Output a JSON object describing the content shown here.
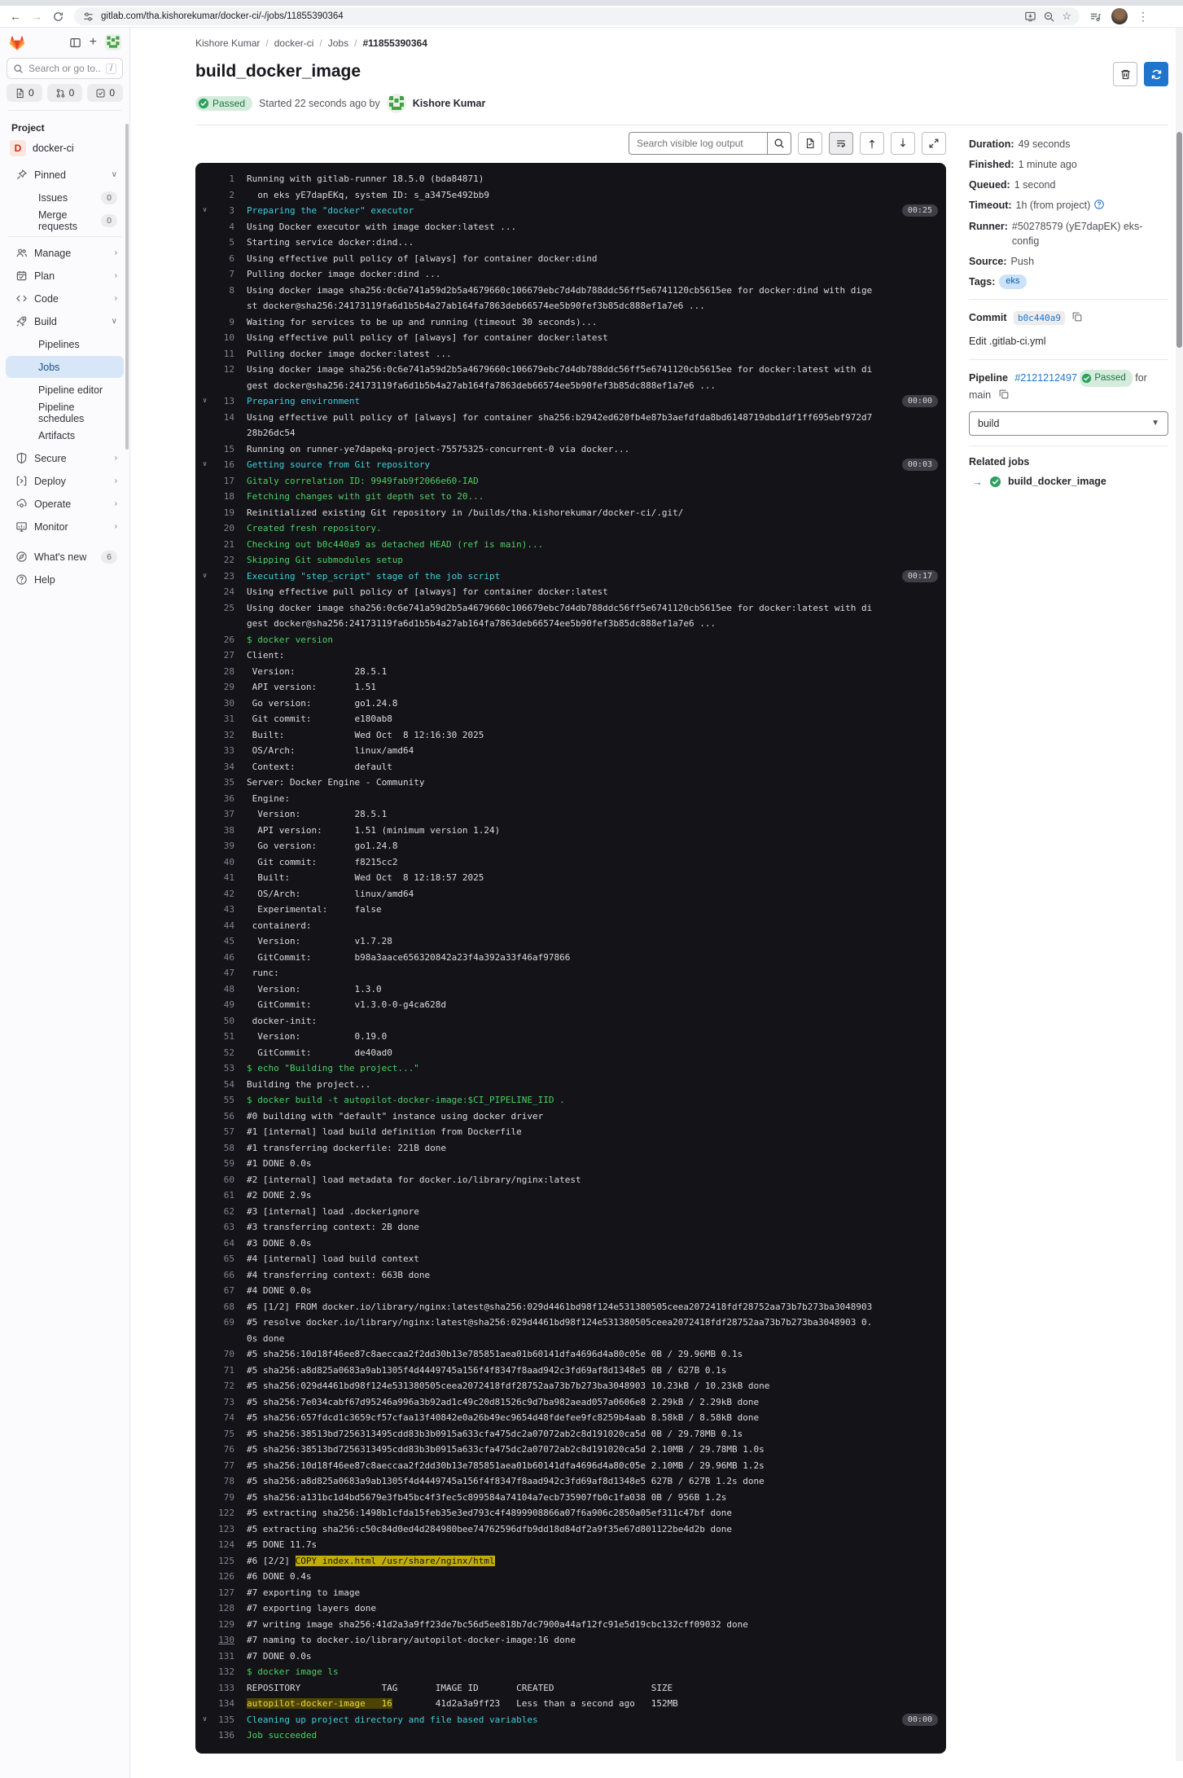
{
  "browser": {
    "url": "gitlab.com/tha.kishorekumar/docker-ci/-/jobs/11855390364"
  },
  "breadcrumb": {
    "items": [
      "Kishore Kumar",
      "docker-ci",
      "Jobs",
      "#11855390364"
    ]
  },
  "sidebar": {
    "search_placeholder": "Search or go to...",
    "shortcut_key": "/",
    "counts": [
      {
        "icon": "issues-count-icon",
        "glyph": "doc",
        "value": "0"
      },
      {
        "icon": "merge-request-count-icon",
        "glyph": "mr",
        "value": "0"
      },
      {
        "icon": "todos-count-icon",
        "glyph": "tasks",
        "value": "0"
      }
    ],
    "section_label": "Project",
    "project": {
      "initial": "D",
      "name": "docker-ci"
    },
    "nav": [
      {
        "label": "Pinned",
        "icon": "pin",
        "chevron": "down"
      },
      {
        "label": "Issues",
        "sub": true,
        "badge": "0"
      },
      {
        "label": "Merge requests",
        "sub": true,
        "badge": "0"
      },
      {
        "divider": true
      },
      {
        "label": "Manage",
        "icon": "users",
        "chevron": "right"
      },
      {
        "label": "Plan",
        "icon": "calendar",
        "chevron": "right"
      },
      {
        "label": "Code",
        "icon": "code",
        "chevron": "right"
      },
      {
        "label": "Build",
        "icon": "rocket",
        "chevron": "down"
      },
      {
        "label": "Pipelines",
        "sub": true
      },
      {
        "label": "Jobs",
        "sub": true,
        "active": true
      },
      {
        "label": "Pipeline editor",
        "sub": true
      },
      {
        "label": "Pipeline schedules",
        "sub": true
      },
      {
        "label": "Artifacts",
        "sub": true
      },
      {
        "label": "Secure",
        "icon": "shield",
        "chevron": "right"
      },
      {
        "label": "Deploy",
        "icon": "deploy",
        "chevron": "right"
      },
      {
        "label": "Operate",
        "icon": "operate",
        "chevron": "right"
      },
      {
        "label": "Monitor",
        "icon": "monitor",
        "chevron": "right"
      }
    ],
    "footer": [
      {
        "label": "What's new",
        "icon": "compass",
        "badge": "6"
      },
      {
        "label": "Help",
        "icon": "question"
      }
    ]
  },
  "job": {
    "title": "build_docker_image",
    "status": "Passed",
    "started_text": "Started 22 seconds ago by",
    "author": "Kishore Kumar"
  },
  "log_toolbar": {
    "search_placeholder": "Search visible log output"
  },
  "details": {
    "rows": [
      {
        "label": "Duration:",
        "value": "49 seconds"
      },
      {
        "label": "Finished:",
        "value": "1 minute ago"
      },
      {
        "label": "Queued:",
        "value": "1 second"
      },
      {
        "label": "Timeout:",
        "value": "1h (from project)",
        "help": true
      },
      {
        "label": "Runner:",
        "value": "#50278579 (yE7dapEK) eks-config"
      },
      {
        "label": "Source:",
        "value": "Push"
      },
      {
        "label": "Tags:",
        "tag": "eks"
      }
    ],
    "commit_label": "Commit",
    "commit_sha": "b0c440a9",
    "edit_link": "Edit .gitlab-ci.yml",
    "pipeline_label": "Pipeline",
    "pipeline_id": "#2121212497",
    "pipeline_status": "Passed",
    "pipeline_for": "for main",
    "stage_selector": "build",
    "related_jobs_label": "Related jobs",
    "related_jobs": [
      {
        "name": "build_docker_image",
        "status": "passed"
      }
    ]
  },
  "log": {
    "lines": [
      {
        "n": 1,
        "c": "w",
        "t": "Running with gitlab-runner 18.5.0 (bda84871)"
      },
      {
        "n": 2,
        "c": "w",
        "t": "  on eks yE7dapEKq, system ID: s_a3475e492bb9"
      },
      {
        "n": 3,
        "c": "s",
        "d": "00:25",
        "t": "Preparing the \"docker\" executor"
      },
      {
        "n": 4,
        "c": "w",
        "t": "Using Docker executor with image docker:latest ..."
      },
      {
        "n": 5,
        "c": "w",
        "t": "Starting service docker:dind..."
      },
      {
        "n": 6,
        "c": "w",
        "t": "Using effective pull policy of [always] for container docker:dind"
      },
      {
        "n": 7,
        "c": "w",
        "t": "Pulling docker image docker:dind ..."
      },
      {
        "n": 8,
        "c": "w",
        "t": "Using docker image sha256:0c6e741a59d2b5a4679660c106679ebc7d4db788ddc56ff5e6741120cb5615ee for docker:dind with digest docker@sha256:24173119fa6d1b5b4a27ab164fa7863deb66574ee5b90fef3b85dc888ef1a7e6 ..."
      },
      {
        "n": 9,
        "c": "w",
        "t": "Waiting for services to be up and running (timeout 30 seconds)..."
      },
      {
        "n": 10,
        "c": "w",
        "t": "Using effective pull policy of [always] for container docker:latest"
      },
      {
        "n": 11,
        "c": "w",
        "t": "Pulling docker image docker:latest ..."
      },
      {
        "n": 12,
        "c": "w",
        "t": "Using docker image sha256:0c6e741a59d2b5a4679660c106679ebc7d4db788ddc56ff5e6741120cb5615ee for docker:latest with digest docker@sha256:24173119fa6d1b5b4a27ab164fa7863deb66574ee5b90fef3b85dc888ef1a7e6 ..."
      },
      {
        "n": 13,
        "c": "s",
        "d": "00:00",
        "t": "Preparing environment"
      },
      {
        "n": 14,
        "c": "w",
        "t": "Using effective pull policy of [always] for container sha256:b2942ed620fb4e87b3aefdfda8bd6148719dbd1df1ff695ebf972d728b26dc54"
      },
      {
        "n": 15,
        "c": "w",
        "t": "Running on runner-ye7dapekq-project-75575325-concurrent-0 via docker..."
      },
      {
        "n": 16,
        "c": "s",
        "d": "00:03",
        "t": "Getting source from Git repository"
      },
      {
        "n": 17,
        "c": "g",
        "t": "Gitaly correlation ID: 9949fab9f2066e60-IAD"
      },
      {
        "n": 18,
        "c": "g",
        "t": "Fetching changes with git depth set to 20..."
      },
      {
        "n": 19,
        "c": "w",
        "t": "Reinitialized existing Git repository in /builds/tha.kishorekumar/docker-ci/.git/"
      },
      {
        "n": 20,
        "c": "g",
        "t": "Created fresh repository."
      },
      {
        "n": 21,
        "c": "g",
        "t": "Checking out b0c440a9 as detached HEAD (ref is main)..."
      },
      {
        "n": 22,
        "c": "g",
        "t": "Skipping Git submodules setup"
      },
      {
        "n": 23,
        "c": "s",
        "d": "00:17",
        "t": "Executing \"step_script\" stage of the job script"
      },
      {
        "n": 24,
        "c": "w",
        "t": "Using effective pull policy of [always] for container docker:latest"
      },
      {
        "n": 25,
        "c": "w",
        "t": "Using docker image sha256:0c6e741a59d2b5a4679660c106679ebc7d4db788ddc56ff5e6741120cb5615ee for docker:latest with digest docker@sha256:24173119fa6d1b5b4a27ab164fa7863deb66574ee5b90fef3b85dc888ef1a7e6 ..."
      },
      {
        "n": 26,
        "c": "g",
        "t": "$ docker version"
      },
      {
        "n": 27,
        "c": "w",
        "t": "Client:"
      },
      {
        "n": 28,
        "c": "w",
        "t": " Version:           28.5.1"
      },
      {
        "n": 29,
        "c": "w",
        "t": " API version:       1.51"
      },
      {
        "n": 30,
        "c": "w",
        "t": " Go version:        go1.24.8"
      },
      {
        "n": 31,
        "c": "w",
        "t": " Git commit:        e180ab8"
      },
      {
        "n": 32,
        "c": "w",
        "t": " Built:             Wed Oct  8 12:16:30 2025"
      },
      {
        "n": 33,
        "c": "w",
        "t": " OS/Arch:           linux/amd64"
      },
      {
        "n": 34,
        "c": "w",
        "t": " Context:           default"
      },
      {
        "n": 35,
        "c": "w",
        "t": "Server: Docker Engine - Community"
      },
      {
        "n": 36,
        "c": "w",
        "t": " Engine:"
      },
      {
        "n": 37,
        "c": "w",
        "t": "  Version:          28.5.1"
      },
      {
        "n": 38,
        "c": "w",
        "t": "  API version:      1.51 (minimum version 1.24)"
      },
      {
        "n": 39,
        "c": "w",
        "t": "  Go version:       go1.24.8"
      },
      {
        "n": 40,
        "c": "w",
        "t": "  Git commit:       f8215cc2"
      },
      {
        "n": 41,
        "c": "w",
        "t": "  Built:            Wed Oct  8 12:18:57 2025"
      },
      {
        "n": 42,
        "c": "w",
        "t": "  OS/Arch:          linux/amd64"
      },
      {
        "n": 43,
        "c": "w",
        "t": "  Experimental:     false"
      },
      {
        "n": 44,
        "c": "w",
        "t": " containerd:"
      },
      {
        "n": 45,
        "c": "w",
        "t": "  Version:          v1.7.28"
      },
      {
        "n": 46,
        "c": "w",
        "t": "  GitCommit:        b98a3aace656320842a23f4a392a33f46af97866"
      },
      {
        "n": 47,
        "c": "w",
        "t": " runc:"
      },
      {
        "n": 48,
        "c": "w",
        "t": "  Version:          1.3.0"
      },
      {
        "n": 49,
        "c": "w",
        "t": "  GitCommit:        v1.3.0-0-g4ca628d"
      },
      {
        "n": 50,
        "c": "w",
        "t": " docker-init:"
      },
      {
        "n": 51,
        "c": "w",
        "t": "  Version:          0.19.0"
      },
      {
        "n": 52,
        "c": "w",
        "t": "  GitCommit:        de40ad0"
      },
      {
        "n": 53,
        "c": "g",
        "t": "$ echo \"Building the project...\""
      },
      {
        "n": 54,
        "c": "w",
        "t": "Building the project..."
      },
      {
        "n": 55,
        "c": "g",
        "t": "$ docker build -t autopilot-docker-image:$CI_PIPELINE_IID ."
      },
      {
        "n": 56,
        "c": "w",
        "t": "#0 building with \"default\" instance using docker driver"
      },
      {
        "n": 57,
        "c": "w",
        "t": "#1 [internal] load build definition from Dockerfile"
      },
      {
        "n": 58,
        "c": "w",
        "t": "#1 transferring dockerfile: 221B done"
      },
      {
        "n": 59,
        "c": "w",
        "t": "#1 DONE 0.0s"
      },
      {
        "n": 60,
        "c": "w",
        "t": "#2 [internal] load metadata for docker.io/library/nginx:latest"
      },
      {
        "n": 61,
        "c": "w",
        "t": "#2 DONE 2.9s"
      },
      {
        "n": 62,
        "c": "w",
        "t": "#3 [internal] load .dockerignore"
      },
      {
        "n": 63,
        "c": "w",
        "t": "#3 transferring context: 2B done"
      },
      {
        "n": 64,
        "c": "w",
        "t": "#3 DONE 0.0s"
      },
      {
        "n": 65,
        "c": "w",
        "t": "#4 [internal] load build context"
      },
      {
        "n": 66,
        "c": "w",
        "t": "#4 transferring context: 663B done"
      },
      {
        "n": 67,
        "c": "w",
        "t": "#4 DONE 0.0s"
      },
      {
        "n": 68,
        "c": "w",
        "t": "#5 [1/2] FROM docker.io/library/nginx:latest@sha256:029d4461bd98f124e531380505ceea2072418fdf28752aa73b7b273ba3048903"
      },
      {
        "n": 69,
        "c": "w",
        "t": "#5 resolve docker.io/library/nginx:latest@sha256:029d4461bd98f124e531380505ceea2072418fdf28752aa73b7b273ba3048903 0.0s done"
      },
      {
        "n": 70,
        "c": "w",
        "t": "#5 sha256:10d18f46ee87c8aeccaa2f2dd30b13e785851aea01b60141dfa4696d4a80c05e 0B / 29.96MB 0.1s"
      },
      {
        "n": 71,
        "c": "w",
        "t": "#5 sha256:a8d825a0683a9ab1305f4d4449745a156f4f8347f8aad942c3fd69af8d1348e5 0B / 627B 0.1s"
      },
      {
        "n": 72,
        "c": "w",
        "t": "#5 sha256:029d4461bd98f124e531380505ceea2072418fdf28752aa73b7b273ba3048903 10.23kB / 10.23kB done"
      },
      {
        "n": 73,
        "c": "w",
        "t": "#5 sha256:7e034cabf67d95246a996a3b92ad1c49c20d81526c9d7ba982aead057a0606e8 2.29kB / 2.29kB done"
      },
      {
        "n": 74,
        "c": "w",
        "t": "#5 sha256:657fdcd1c3659cf57cfaa13f40842e0a26b49ec9654d48fdefee9fc8259b4aab 8.58kB / 8.58kB done"
      },
      {
        "n": 75,
        "c": "w",
        "t": "#5 sha256:38513bd7256313495cdd83b3b0915a633cfa475dc2a07072ab2c8d191020ca5d 0B / 29.78MB 0.1s"
      },
      {
        "n": 76,
        "c": "w",
        "t": "#5 sha256:38513bd7256313495cdd83b3b0915a633cfa475dc2a07072ab2c8d191020ca5d 2.10MB / 29.78MB 1.0s"
      },
      {
        "n": 77,
        "c": "w",
        "t": "#5 sha256:10d18f46ee87c8aeccaa2f2dd30b13e785851aea01b60141dfa4696d4a80c05e 2.10MB / 29.96MB 1.2s"
      },
      {
        "n": 78,
        "c": "w",
        "t": "#5 sha256:a8d825a0683a9ab1305f4d4449745a156f4f8347f8aad942c3fd69af8d1348e5 627B / 627B 1.2s done"
      },
      {
        "n": 79,
        "c": "w",
        "t": "#5 sha256:a131bc1d4bd5679e3fb45bc4f3fec5c899584a74104a7ecb735907fb0c1fa038 0B / 956B 1.2s"
      },
      {
        "n": 122,
        "c": "w",
        "t": "#5 extracting sha256:1498b1cfda15feb35e3ed793c4f4899908866a07f6a906c2850a05ef311c47bf done"
      },
      {
        "n": 123,
        "c": "w",
        "t": "#5 extracting sha256:c50c84d0ed4d284980bee74762596dfb9dd18d84df2a9f35e67d801122be4d2b done"
      },
      {
        "n": 124,
        "c": "w",
        "t": "#5 DONE 11.7s"
      },
      {
        "n": 125,
        "p": [
          {
            "t": "#6 [2/2] ",
            "c": "lw"
          },
          {
            "t": "COPY index.html /usr/share/nginx/html",
            "c": "hly"
          }
        ]
      },
      {
        "n": 126,
        "c": "w",
        "t": "#6 DONE 0.4s"
      },
      {
        "n": 127,
        "c": "w",
        "t": "#7 exporting to image"
      },
      {
        "n": 128,
        "c": "w",
        "t": "#7 exporting layers done"
      },
      {
        "n": 129,
        "c": "w",
        "t": "#7 writing image sha256:41d2a3a9ff23de7bc56d5ee818b7dc7900a44af12fc91e5d19cbc132cff09032 done"
      },
      {
        "n": 130,
        "c": "w",
        "u": true,
        "t": "#7 naming to docker.io/library/autopilot-docker-image:16 done"
      },
      {
        "n": 131,
        "c": "w",
        "t": "#7 DONE 0.0s"
      },
      {
        "n": 132,
        "c": "g",
        "t": "$ docker image ls"
      },
      {
        "n": 133,
        "c": "w",
        "t": "REPOSITORY               TAG       IMAGE ID       CREATED                  SIZE"
      },
      {
        "n": 134,
        "p": [
          {
            "t": "autopilot-docker-image   16",
            "c": "hlo"
          },
          {
            "t": "        41d2a3a9ff23   Less than a second ago   152MB",
            "c": "lw"
          }
        ]
      },
      {
        "n": 135,
        "c": "s",
        "d": "00:00",
        "t": "Cleaning up project directory and file based variables"
      },
      {
        "n": 136,
        "c": "g",
        "t": "Job succeeded"
      }
    ]
  }
}
